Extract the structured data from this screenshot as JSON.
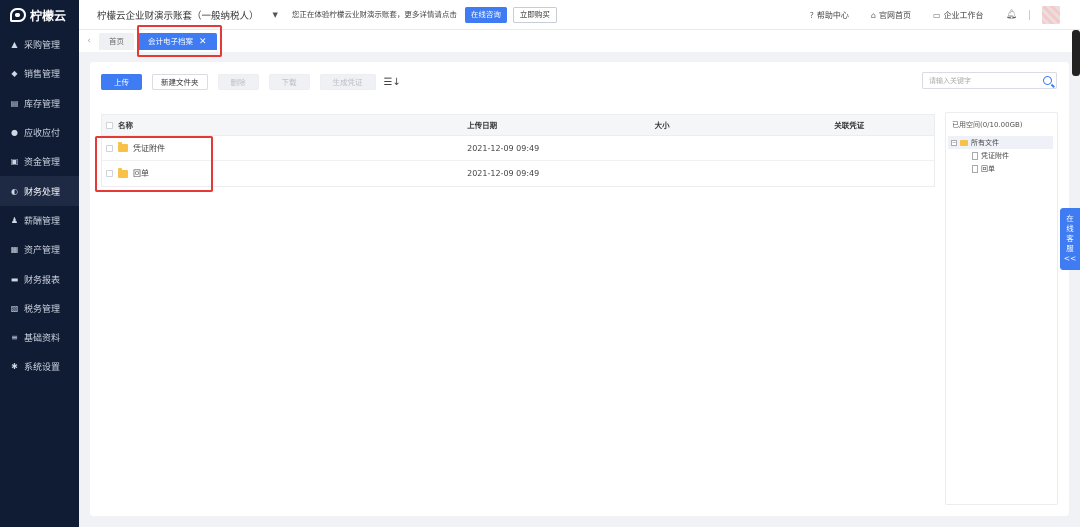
{
  "brand": {
    "name": "柠檬云"
  },
  "sidebar": {
    "items": [
      {
        "label": "采购管理",
        "icon": "shopping-bag-icon"
      },
      {
        "label": "销售管理",
        "icon": "tag-icon"
      },
      {
        "label": "库存管理",
        "icon": "warehouse-icon"
      },
      {
        "label": "应收应付",
        "icon": "coin-icon"
      },
      {
        "label": "资金管理",
        "icon": "wallet-icon"
      },
      {
        "label": "财务处理",
        "icon": "finance-icon",
        "active": true
      },
      {
        "label": "薪酬管理",
        "icon": "person-money-icon"
      },
      {
        "label": "资产管理",
        "icon": "asset-icon"
      },
      {
        "label": "财务报表",
        "icon": "report-icon"
      },
      {
        "label": "税务管理",
        "icon": "tax-icon"
      },
      {
        "label": "基础资料",
        "icon": "database-icon"
      },
      {
        "label": "系统设置",
        "icon": "gear-icon"
      }
    ]
  },
  "header": {
    "company": "柠檬云企业财演示账套（一般纳税人）",
    "notice": "您正在体验柠檬云业财演示账套，更多详情请点击",
    "consult_label": "在线咨询",
    "buy_label": "立即购买",
    "links": [
      {
        "label": "帮助中心",
        "icon": "help-circle-icon"
      },
      {
        "label": "官网首页",
        "icon": "home-icon"
      },
      {
        "label": "企业工作台",
        "icon": "monitor-icon"
      }
    ]
  },
  "tabs": [
    {
      "label": "首页"
    },
    {
      "label": "会计电子档案",
      "active": true
    }
  ],
  "toolbar": {
    "upload": "上传",
    "new_folder": "新建文件夹",
    "delete": "删除",
    "download": "下载",
    "gen_voucher": "生成凭证",
    "search_placeholder": "请输入关键字"
  },
  "table": {
    "columns": [
      "名称",
      "上传日期",
      "大小",
      "关联凭证"
    ],
    "rows": [
      {
        "name": "凭证附件",
        "date": "2021-12-09 09:49",
        "size": "",
        "voucher": ""
      },
      {
        "name": "回单",
        "date": "2021-12-09 09:49",
        "size": "",
        "voucher": ""
      }
    ]
  },
  "storage": {
    "title": "已用空间(0/10.00GB)",
    "root": "所有文件",
    "children": [
      "凭证附件",
      "回单"
    ]
  },
  "service": {
    "label": [
      "在",
      "线",
      "客",
      "服",
      "<<"
    ]
  },
  "colors": {
    "accent": "#3f7cf4",
    "sidebar_bg": "#101c33",
    "highlight": "#e53935"
  }
}
